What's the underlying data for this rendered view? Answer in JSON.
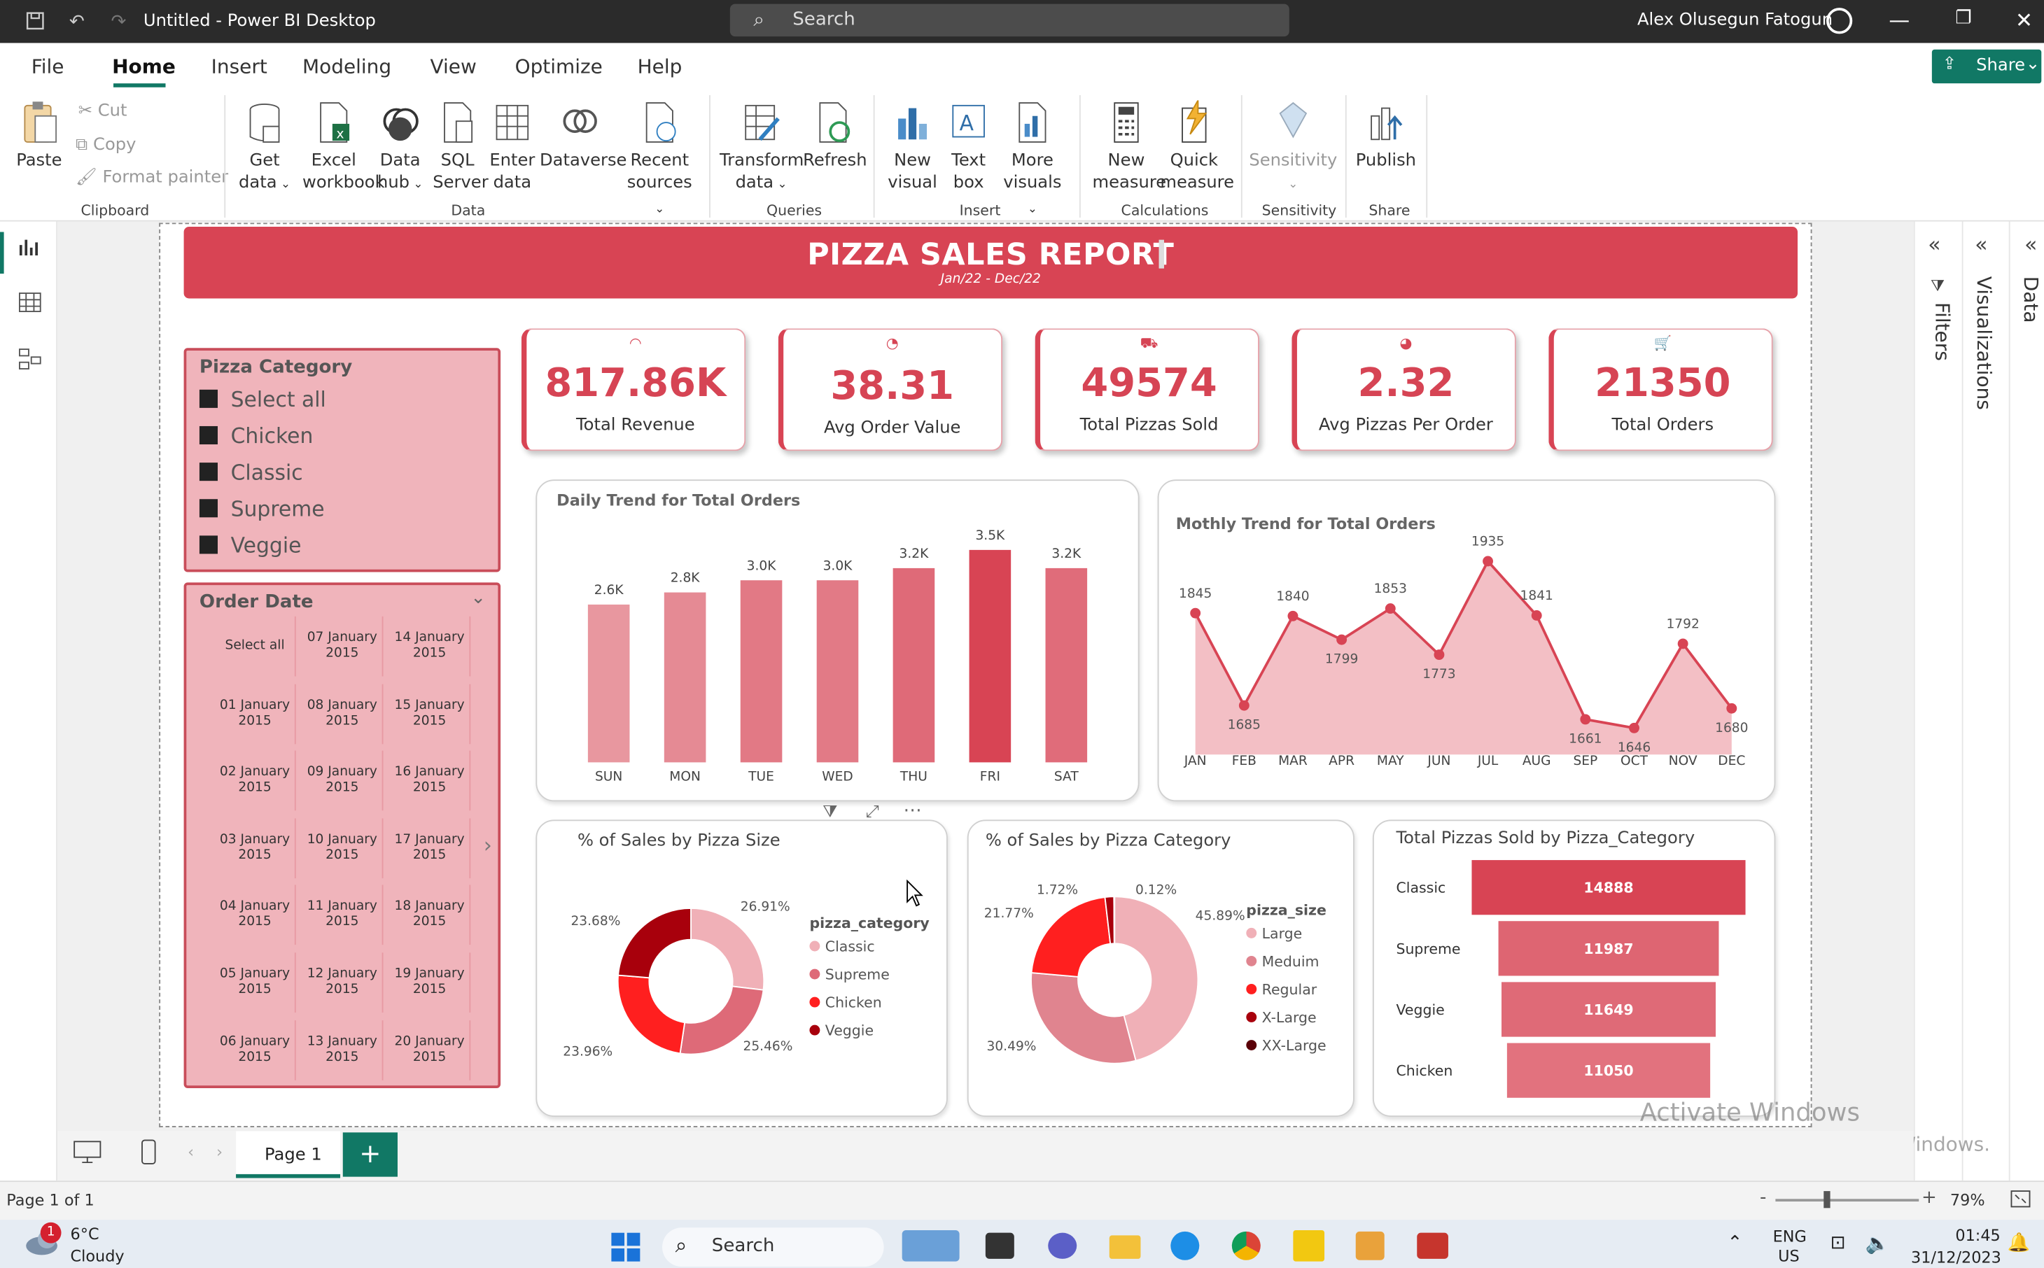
{
  "window": {
    "title": "Untitled - Power BI Desktop",
    "search_placeholder": "Search",
    "user": "Alex Olusegun Fatogun"
  },
  "menu": {
    "items": [
      "File",
      "Home",
      "Insert",
      "Modeling",
      "View",
      "Optimize",
      "Help"
    ],
    "active": "Home",
    "share_label": "Share"
  },
  "ribbon": {
    "clipboard": {
      "paste": "Paste",
      "cut": "Cut",
      "copy": "Copy",
      "format_painter": "Format painter",
      "group": "Clipboard"
    },
    "data": {
      "get_data": [
        "Get",
        "data"
      ],
      "excel": [
        "Excel",
        "workbook"
      ],
      "data_hub": [
        "Data",
        "hub"
      ],
      "sql": [
        "SQL",
        "Server"
      ],
      "enter": [
        "Enter",
        "data"
      ],
      "dataverse": "Dataverse",
      "recent": [
        "Recent",
        "sources"
      ],
      "group": "Data"
    },
    "queries": {
      "transform": [
        "Transform",
        "data"
      ],
      "refresh": "Refresh",
      "group": "Queries"
    },
    "insert": {
      "new_visual": [
        "New",
        "visual"
      ],
      "text_box": [
        "Text",
        "box"
      ],
      "more": [
        "More",
        "visuals"
      ],
      "group": "Insert"
    },
    "calculations": {
      "new_measure": [
        "New",
        "measure"
      ],
      "quick_measure": [
        "Quick",
        "measure"
      ],
      "group": "Calculations"
    },
    "sensitivity": {
      "label": "Sensitivity",
      "group": "Sensitivity"
    },
    "share": {
      "publish": "Publish",
      "group": "Share"
    }
  },
  "report": {
    "title": "PIZZA SALES REPORT",
    "subtitle": "Jan/22 - Dec/22",
    "kpis": [
      {
        "value": "817.86K",
        "label": "Total Revenue"
      },
      {
        "value": "38.31",
        "label": "Avg Order Value"
      },
      {
        "value": "49574",
        "label": "Total Pizzas Sold"
      },
      {
        "value": "2.32",
        "label": "Avg Pizzas Per Order"
      },
      {
        "value": "21350",
        "label": "Total Orders"
      }
    ],
    "category_slicer": {
      "title": "Pizza Category",
      "options": [
        "Select all",
        "Chicken",
        "Classic",
        "Supreme",
        "Veggie"
      ]
    },
    "date_slicer": {
      "title": "Order Date",
      "rows": [
        [
          "Select all",
          "07 January 2015",
          "14 January 2015"
        ],
        [
          "01 January 2015",
          "08 January 2015",
          "15 January 2015"
        ],
        [
          "02 January 2015",
          "09 January 2015",
          "16 January 2015"
        ],
        [
          "03 January 2015",
          "10 January 2015",
          "17 January 2015"
        ],
        [
          "04 January 2015",
          "11 January 2015",
          "18 January 2015"
        ],
        [
          "05 January 2015",
          "12 January 2015",
          "19 January 2015"
        ],
        [
          "06 January 2015",
          "13 January 2015",
          "20 January 2015"
        ]
      ]
    }
  },
  "chart_data": [
    {
      "type": "bar",
      "title": "Daily Trend for Total Orders",
      "categories": [
        "SUN",
        "MON",
        "TUE",
        "WED",
        "THU",
        "FRI",
        "SAT"
      ],
      "values": [
        2600,
        2800,
        3000,
        3000,
        3200,
        3500,
        3200
      ],
      "labels": [
        "2.6K",
        "2.8K",
        "3.0K",
        "3.0K",
        "3.2K",
        "3.5K",
        "3.2K"
      ],
      "colors": [
        "#e8979f",
        "#e58a94",
        "#e27985",
        "#e27a86",
        "#df6a78",
        "#d84454",
        "#e06c7a"
      ]
    },
    {
      "type": "area",
      "title": "Mothly Trend for Total Orders",
      "categories": [
        "JAN",
        "FEB",
        "MAR",
        "APR",
        "MAY",
        "JUN",
        "JUL",
        "AUG",
        "SEP",
        "OCT",
        "NOV",
        "DEC"
      ],
      "values": [
        1845,
        1685,
        1840,
        1799,
        1853,
        1773,
        1935,
        1841,
        1661,
        1646,
        1792,
        1680
      ],
      "labels": [
        "1845",
        "1685",
        "1840",
        "1799",
        "1853",
        "1773",
        "1935",
        "1841",
        "1661",
        "1646",
        "1792",
        "1680"
      ],
      "ylim": [
        1600,
        1950
      ],
      "line_color": "#d84454",
      "fill_color": "#f2b8bf"
    },
    {
      "type": "pie",
      "title": "% of Sales by Pizza Size",
      "legend_title": "pizza_category",
      "slices": [
        {
          "name": "Classic",
          "value": 26.91,
          "label": "26.91%",
          "color": "#f0b0b7"
        },
        {
          "name": "Supreme",
          "value": 25.46,
          "label": "25.46%",
          "color": "#de6a78"
        },
        {
          "name": "Chicken",
          "value": 23.96,
          "label": "23.96%",
          "color": "#ff1f1f"
        },
        {
          "name": "Veggie",
          "value": 23.68,
          "label": "23.68%",
          "color": "#a8000c"
        }
      ]
    },
    {
      "type": "pie",
      "title": "% of Sales by Pizza Category",
      "legend_title": "pizza_size",
      "slices": [
        {
          "name": "Large",
          "value": 45.89,
          "label": "45.89%",
          "color": "#f0b0b7"
        },
        {
          "name": "Meduim",
          "value": 30.49,
          "label": "30.49%",
          "color": "#e0848f"
        },
        {
          "name": "Regular",
          "value": 21.77,
          "label": "21.77%",
          "color": "#ff1f1f"
        },
        {
          "name": "X-Large",
          "value": 1.72,
          "label": "1.72%",
          "color": "#a8000c"
        },
        {
          "name": "XX-Large",
          "value": 0.12,
          "label": "0.12%",
          "color": "#5a0008"
        }
      ]
    },
    {
      "type": "bar",
      "title": "Total Pizzas Sold by Pizza_Category",
      "orientation": "funnel",
      "categories": [
        "Classic",
        "Supreme",
        "Veggie",
        "Chicken"
      ],
      "values": [
        14888,
        11987,
        11649,
        11050
      ],
      "labels": [
        "14888",
        "11987",
        "11649",
        "11050"
      ],
      "colors": [
        "#d84454",
        "#de6572",
        "#df6a77",
        "#e2727e"
      ]
    }
  ],
  "side_panes": [
    "Filters",
    "Visualizations",
    "Data"
  ],
  "pages": {
    "tab": "Page 1",
    "status": "Page 1 of 1",
    "zoom": "79%"
  },
  "watermark": {
    "line1": "Activate Windows",
    "line2": "Go to Settings to activate Windows."
  },
  "taskbar": {
    "weather_temp": "6°C",
    "weather_desc": "Cloudy",
    "notification_count": "1",
    "search": "Search",
    "lang1": "ENG",
    "lang2": "US",
    "time": "01:45",
    "date": "31/12/2023"
  }
}
